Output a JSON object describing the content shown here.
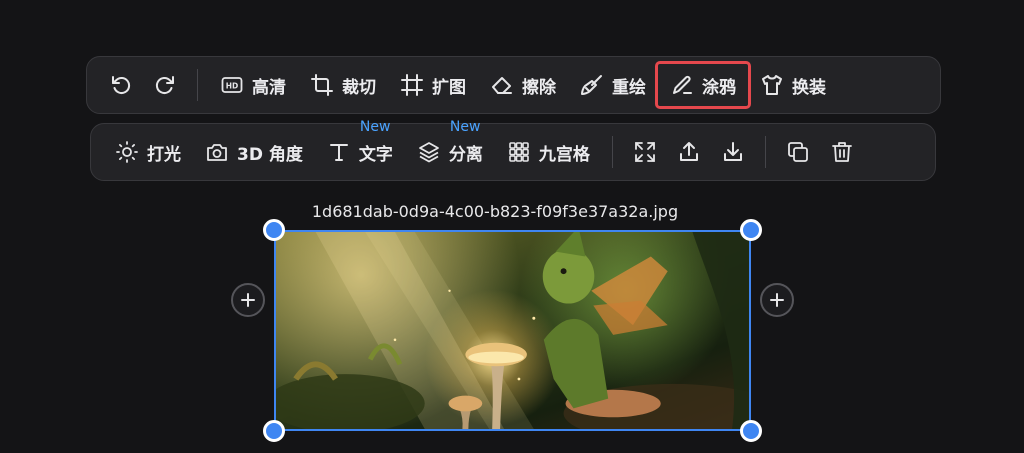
{
  "toolbar_top": {
    "undo_icon": "undo-icon",
    "redo_icon": "redo-icon",
    "tools": [
      {
        "label": "高清",
        "icon": "hd-icon"
      },
      {
        "label": "裁切",
        "icon": "crop-icon"
      },
      {
        "label": "扩图",
        "icon": "expand-frame-icon"
      },
      {
        "label": "擦除",
        "icon": "eraser-icon"
      },
      {
        "label": "重绘",
        "icon": "brush-icon"
      },
      {
        "label": "涂鸦",
        "icon": "pencil-icon",
        "active": true
      },
      {
        "label": "换装",
        "icon": "shirt-icon"
      }
    ]
  },
  "toolbar_bottom": {
    "tools": [
      {
        "label": "打光",
        "icon": "sun-icon"
      },
      {
        "label": "3D 角度",
        "icon": "camera-icon"
      },
      {
        "label": "文字",
        "icon": "text-icon",
        "badge": "New"
      },
      {
        "label": "分离",
        "icon": "layers-icon",
        "badge": "New"
      },
      {
        "label": "九宫格",
        "icon": "grid-icon"
      }
    ],
    "actions": [
      "fullscreen-icon",
      "upload-icon",
      "download-icon",
      "copy-icon",
      "trash-icon"
    ]
  },
  "canvas": {
    "filename": "1d681dab-0d9a-4c00-b823-f09f3e37a32a.jpg"
  },
  "colors": {
    "accent": "#3f86f2",
    "active_outline": "#e5484d",
    "badge": "#4aa3ff"
  }
}
